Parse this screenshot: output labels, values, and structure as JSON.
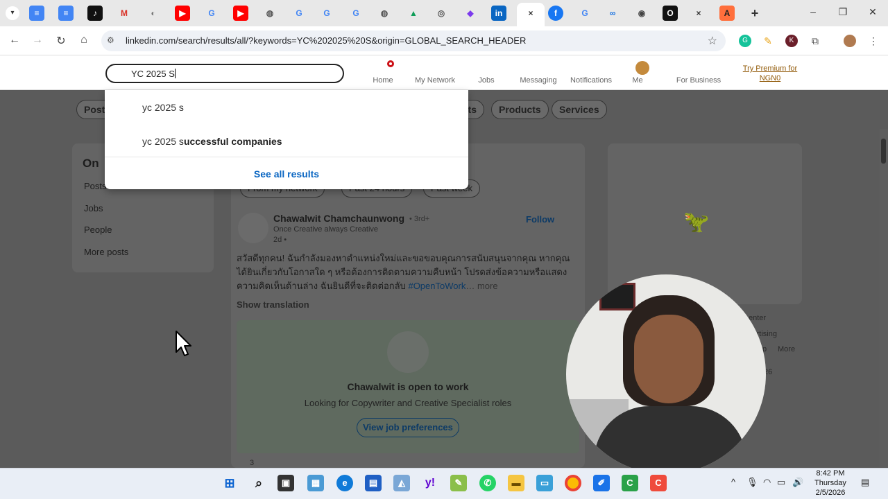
{
  "browser": {
    "url": "linkedin.com/search/results/all/?keywords=YC%202025%20S&origin=GLOBAL_SEARCH_HEADER",
    "active_tab_close": "×",
    "new_tab": "+"
  },
  "linkedin": {
    "search_value": "YC 2025 S",
    "nav": {
      "home": "Home",
      "network": "My Network",
      "jobs": "Jobs",
      "messaging": "Messaging",
      "notifications": "Notifications",
      "me": "Me",
      "business": "For Business",
      "premium": "Try Premium for NGN0"
    },
    "dropdown": {
      "suggestions": [
        {
          "typed": "yc 2025 s",
          "completion": ""
        },
        {
          "typed": "yc 2025 s",
          "completion": "uccessful companies"
        }
      ],
      "see_all": "See all results"
    },
    "filters": {
      "posts": "Post",
      "ents": "nts",
      "products": "Products",
      "services": "Services"
    },
    "left_panel": {
      "title": "On",
      "links": [
        "Posts",
        "Jobs",
        "People",
        "More posts"
      ]
    },
    "subfilters": {
      "network": "From my network",
      "day": "Past 24 hours",
      "week": "Past week"
    },
    "post": {
      "author": "Chawalwit Chamchaunwong",
      "degree": "• 3rd+",
      "subtitle": "Once Creative always Creative",
      "time": "2d •",
      "follow": "Follow",
      "text": "สวัสดีทุกคน! ฉันกำลังมองหาตำแหน่งใหม่และขอขอบคุณการสนับสนุนจากคุณ หากคุณได้ยินเกี่ยวกับโอกาสใด ๆ หรือต้องการติดตามความคืบหน้า โปรดส่งข้อความหรือแสดงความคิดเห็นด้านล่าง ฉันยินดีที่จะติดต่อกลับ",
      "hashtag": "#OpenToWork",
      "more": "… more",
      "show_translation": "Show translation",
      "open_to_work_title": "Chawalwit is open to work",
      "open_to_work_sub": "Looking for Copywriter and Creative Specialist roles",
      "view_prefs": "View job preferences",
      "count": "3"
    },
    "right_rail": {
      "center": "enter",
      "advertising": "vertising",
      "p": "p",
      "more": "More",
      "year": "26"
    }
  },
  "taskbar": {
    "time": "8:42 PM",
    "day": "Thursday",
    "date": "2/5/2026"
  }
}
